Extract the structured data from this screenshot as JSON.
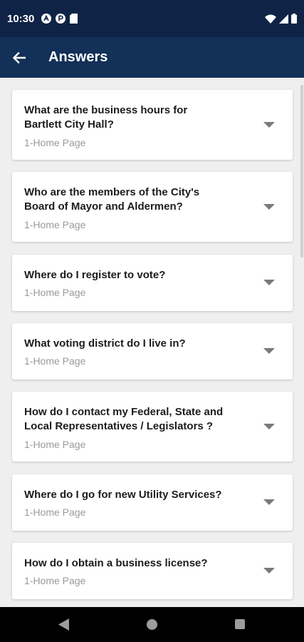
{
  "status": {
    "time": "10:30"
  },
  "app_bar": {
    "title": "Answers"
  },
  "cards": [
    {
      "question": "What are the business hours for Bartlett City Hall?",
      "category": "1-Home Page"
    },
    {
      "question": "Who are the members of the City's Board of Mayor and Aldermen?",
      "category": "1-Home Page"
    },
    {
      "question": "Where do I register to vote?",
      "category": "1-Home Page"
    },
    {
      "question": "What voting district do I live in?",
      "category": "1-Home Page"
    },
    {
      "question": "How do I contact my Federal, State and Local Representatives / Legislators ?",
      "category": "1-Home Page"
    },
    {
      "question": "Where do I go for new Utility Services?",
      "category": "1-Home Page"
    },
    {
      "question": "How do I obtain a business license?",
      "category": "1-Home Page"
    }
  ],
  "icons": {
    "status_left": [
      "circle-a-icon",
      "circle-p-icon",
      "sd-card-icon"
    ],
    "status_right": [
      "wifi-icon",
      "signal-icon",
      "battery-icon"
    ],
    "nav": [
      "back-triangle-icon",
      "home-circle-icon",
      "recents-square-icon"
    ],
    "card_expand": "chevron-down-icon"
  },
  "colors": {
    "status_bar": "#0e2346",
    "app_bar": "#123058",
    "background": "#efefef"
  }
}
